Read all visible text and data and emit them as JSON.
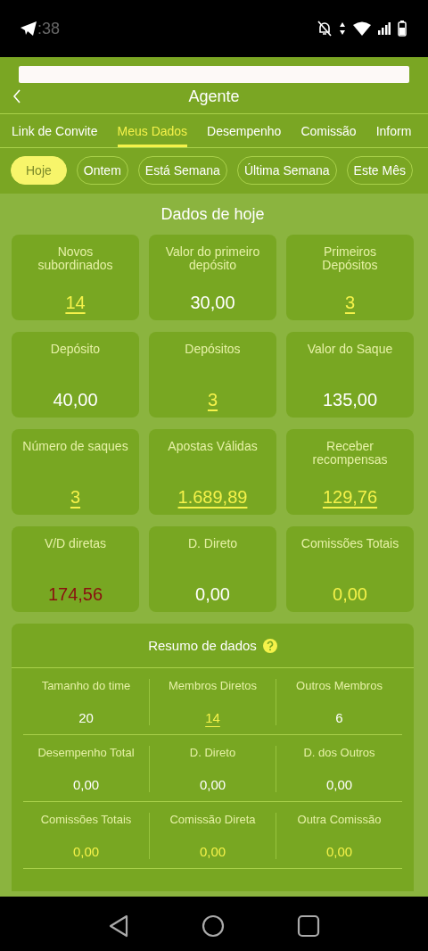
{
  "status_bar": {
    "time": ":38"
  },
  "header": {
    "title": "Agente"
  },
  "tabs": [
    {
      "label": "Link de Convite",
      "selected": false
    },
    {
      "label": "Meus Dados",
      "selected": true
    },
    {
      "label": "Desempenho",
      "selected": false
    },
    {
      "label": "Comissão",
      "selected": false
    },
    {
      "label": "Inform",
      "selected": false
    }
  ],
  "periods": [
    {
      "label": "Hoje",
      "selected": true
    },
    {
      "label": "Ontem",
      "selected": false
    },
    {
      "label": "Está Semana",
      "selected": false
    },
    {
      "label": "Última Semana",
      "selected": false
    },
    {
      "label": "Este Mês",
      "selected": false
    }
  ],
  "section_title": "Dados de hoje",
  "stats": [
    {
      "label": "Novos subordinados",
      "value": "14",
      "kind": "link"
    },
    {
      "label": "Valor do primeiro depósito",
      "value": "30,00",
      "kind": "plain"
    },
    {
      "label": "Primeiros Depósitos",
      "value": "3",
      "kind": "link"
    },
    {
      "label": "Depósito",
      "value": "40,00",
      "kind": "plain"
    },
    {
      "label": "Depósitos",
      "value": "3",
      "kind": "link"
    },
    {
      "label": "Valor do Saque",
      "value": "135,00",
      "kind": "plain"
    },
    {
      "label": "Número de saques",
      "value": "3",
      "kind": "link"
    },
    {
      "label": "Apostas Válidas",
      "value": "1.689,89",
      "kind": "link"
    },
    {
      "label": "Receber recompensas",
      "value": "129,76",
      "kind": "link"
    },
    {
      "label": "V/D diretas",
      "value": "174,56",
      "kind": "negative"
    },
    {
      "label": "D. Direto",
      "value": "0,00",
      "kind": "plain"
    },
    {
      "label": "Comissões Totais",
      "value": "0,00",
      "kind": "highlight"
    }
  ],
  "summary": {
    "title": "Resumo de dados",
    "rows": [
      [
        {
          "label": "Tamanho do time",
          "value": "20",
          "kind": "plain"
        },
        {
          "label": "Membros Diretos",
          "value": "14",
          "kind": "link"
        },
        {
          "label": "Outros Membros",
          "value": "6",
          "kind": "plain"
        }
      ],
      [
        {
          "label": "Desempenho Total",
          "value": "0,00",
          "kind": "plain"
        },
        {
          "label": "D. Direto",
          "value": "0,00",
          "kind": "plain"
        },
        {
          "label": "D. dos Outros",
          "value": "0,00",
          "kind": "plain"
        }
      ],
      [
        {
          "label": "Comissões Totais",
          "value": "0,00",
          "kind": "highlight"
        },
        {
          "label": "Comissão Direta",
          "value": "0,00",
          "kind": "highlight"
        },
        {
          "label": "Outra Comissão",
          "value": "0,00",
          "kind": "highlight"
        }
      ]
    ]
  }
}
